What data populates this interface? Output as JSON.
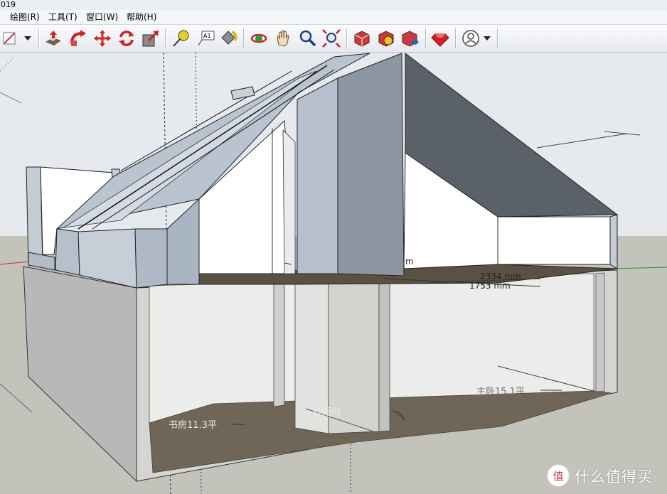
{
  "window": {
    "title_fragment": "019"
  },
  "menu": [
    {
      "label": "绘图(R)"
    },
    {
      "label": "工具(T)"
    },
    {
      "label": "窗口(W)"
    },
    {
      "label": "帮助(H)"
    }
  ],
  "toolbar": {
    "groups": [
      [
        "line-tool-icon",
        "line-tool-dropdown-icon"
      ],
      [
        "push-pull-icon",
        "follow-me-icon",
        "move-icon",
        "rotate-icon",
        "scale-icon"
      ],
      [
        "tape-measure-icon",
        "text-label-icon",
        "paint-bucket-icon"
      ],
      [
        "orbit-icon",
        "pan-icon",
        "zoom-icon",
        "zoom-extents-icon"
      ],
      [
        "get-models-icon",
        "share-component-icon",
        "upload-model-icon"
      ],
      [
        "extension-ruby-icon"
      ],
      [
        "account-icon",
        "account-dropdown-icon"
      ]
    ]
  },
  "viewport": {
    "dimensions": [
      "2334 mm",
      "1753 mm"
    ],
    "partial_dimension_fragment": "m",
    "rooms": [
      {
        "label": "书房11.3平"
      },
      {
        "label": "衣帽间"
      },
      {
        "label": "主卧15.1平"
      }
    ],
    "colors": {
      "sky": "#e6e9ee",
      "ground": "#c3c3bc",
      "wall_face": "#c8ccd2",
      "roof_dark": "#5b6168",
      "floor": "#6f6657"
    }
  },
  "watermark": {
    "text": "什么值得买",
    "badge": "值"
  }
}
